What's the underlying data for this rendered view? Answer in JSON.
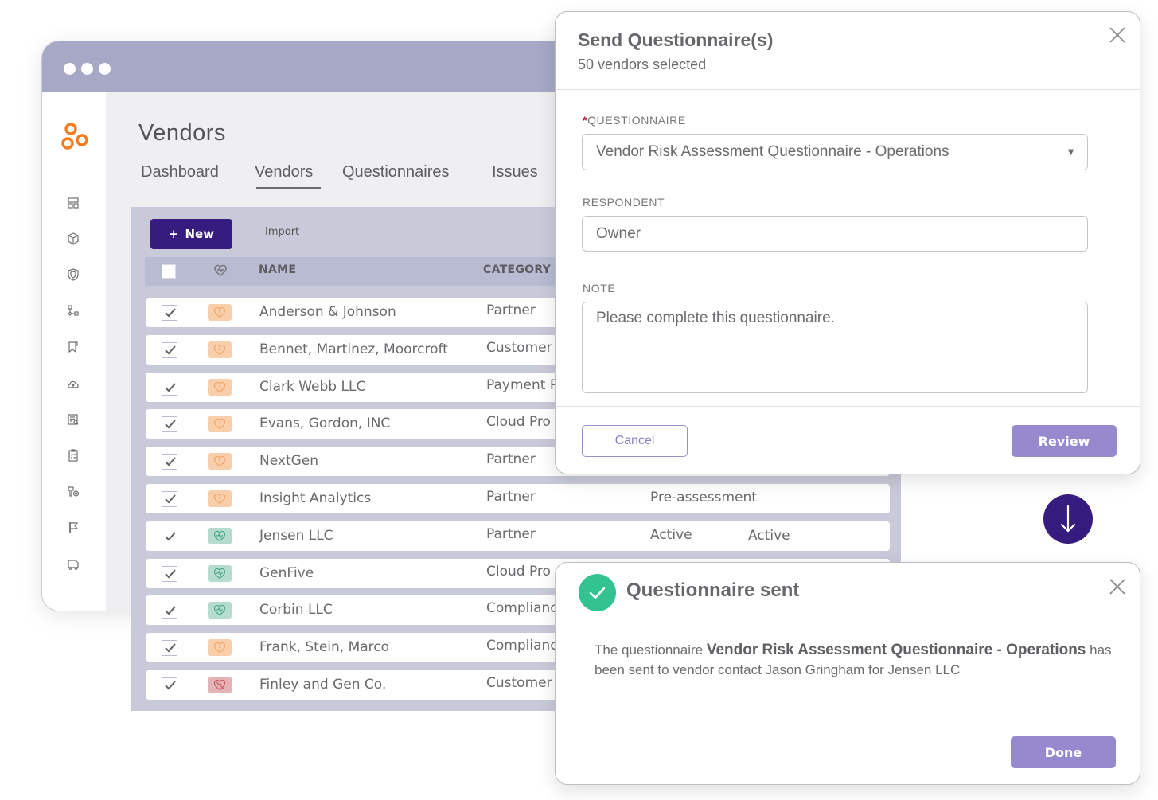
{
  "browser": {
    "app_title": "Vendors",
    "tabs": [
      {
        "label": "Dashboard",
        "active": false
      },
      {
        "label": "Vendors",
        "active": true
      },
      {
        "label": "Questionnaires",
        "active": false
      },
      {
        "label": "Issues",
        "active": false
      }
    ],
    "sidebar_icons": [
      "dashboard-icon",
      "package-icon",
      "shield-icon",
      "workflow-icon",
      "bookmark-icon",
      "cloud-upload-icon",
      "document-search-icon",
      "clipboard-checklist-icon",
      "key-settings-icon",
      "flag-icon",
      "truck-icon"
    ],
    "toolbar": {
      "new_label": "New",
      "import_label": "Import"
    },
    "table": {
      "columns": {
        "name": "NAME",
        "category": "CATEGORY"
      },
      "rows": [
        {
          "name": "Anderson & Johnson",
          "category": "Partner",
          "status1": "",
          "status2": "",
          "health": "warn",
          "checked": true
        },
        {
          "name": "Bennet, Martinez, Moorcroft",
          "category": "Customer",
          "status1": "",
          "status2": "",
          "health": "warn",
          "checked": true
        },
        {
          "name": "Clark Webb LLC",
          "category": "Payment P",
          "status1": "",
          "status2": "",
          "health": "warn",
          "checked": true
        },
        {
          "name": "Evans, Gordon, INC",
          "category": "Cloud Pro",
          "status1": "",
          "status2": "",
          "health": "warn",
          "checked": true
        },
        {
          "name": "NextGen",
          "category": "Partner",
          "status1": "",
          "status2": "",
          "health": "warn",
          "checked": true
        },
        {
          "name": "Insight Analytics",
          "category": "Partner",
          "status1": "Pre-assessment",
          "status2": "",
          "health": "warn",
          "checked": true
        },
        {
          "name": "Jensen LLC",
          "category": "Partner",
          "status1": "Active",
          "status2": "Active",
          "health": "good",
          "checked": true
        },
        {
          "name": "GenFive",
          "category": "Cloud Pro",
          "status1": "",
          "status2": "",
          "health": "good",
          "checked": true
        },
        {
          "name": "Corbin LLC",
          "category": "Complianc",
          "status1": "",
          "status2": "",
          "health": "good",
          "checked": true
        },
        {
          "name": "Frank, Stein, Marco",
          "category": "Complianc",
          "status1": "",
          "status2": "",
          "health": "warn",
          "checked": true
        },
        {
          "name": "Finley and Gen Co.",
          "category": "Customer",
          "status1": "",
          "status2": "",
          "health": "bad",
          "checked": true
        }
      ]
    }
  },
  "send_modal": {
    "title": "Send Questionnaire(s)",
    "subtitle": "50 vendors selected",
    "questionnaire_label": "QUESTIONNAIRE",
    "required_mark": "*",
    "questionnaire_value": "Vendor Risk Assessment Questionnaire - Operations",
    "respondent_label": "RESPONDENT",
    "respondent_value": "Owner",
    "note_label": "NOTE",
    "note_value": "Please complete this questionnaire.",
    "cancel_label": "Cancel",
    "review_label": "Review"
  },
  "sent_modal": {
    "title": "Questionnaire sent",
    "msg_prefix": "The questionnaire ",
    "msg_questionnaire": "Vendor Risk Assessment Questionnaire - Operations",
    "msg_suffix": " has been sent to vendor contact Jason Gringham for Jensen LLC",
    "done_label": "Done"
  },
  "colors": {
    "brand_primary": "#351c7e",
    "button_secondary": "#9789ce",
    "success": "#33c391",
    "logo": "#f47b20",
    "health_warn": "#f9cfab",
    "health_good": "#b6dccf",
    "health_bad": "#e3b3b5"
  }
}
